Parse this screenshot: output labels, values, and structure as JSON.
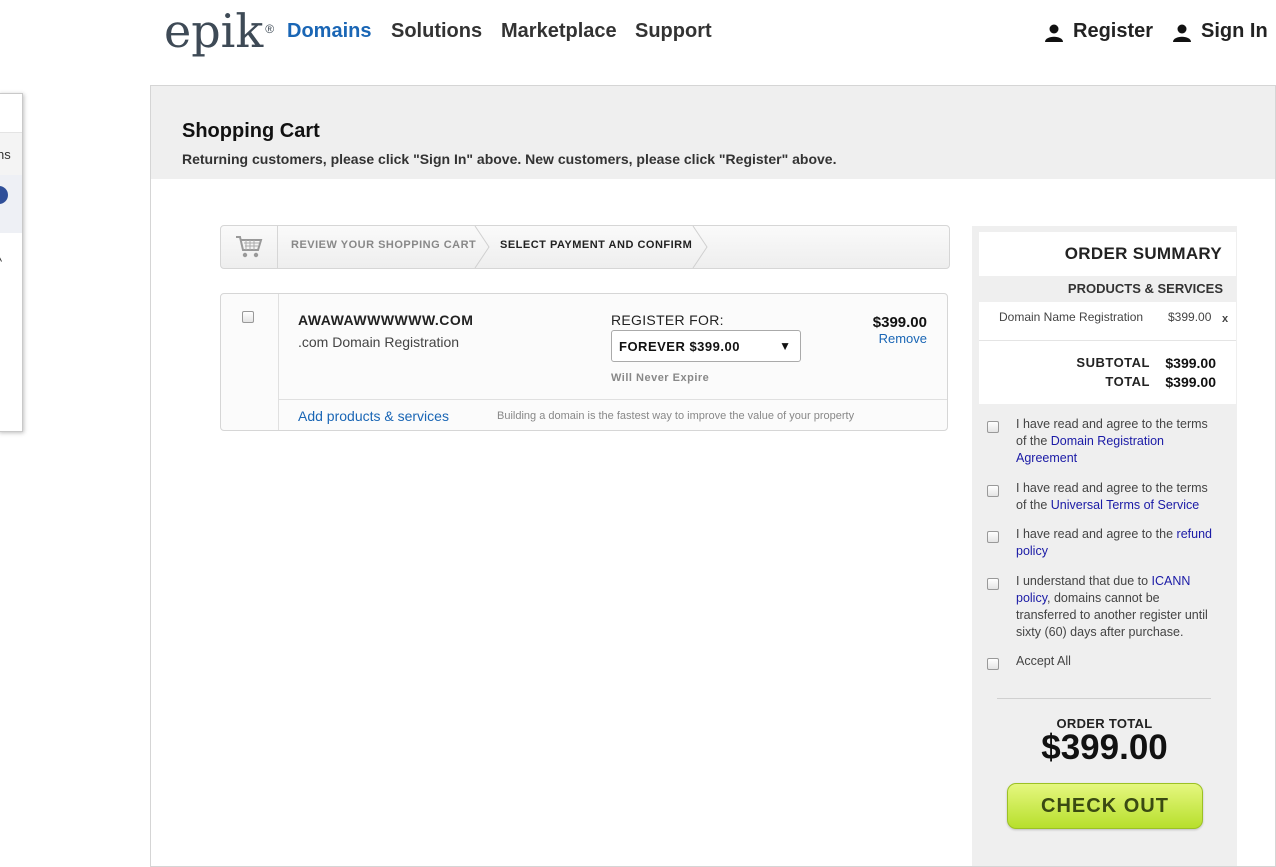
{
  "header": {
    "logo_text": "epik",
    "logo_mark": "®",
    "nav": [
      {
        "label": "Domains",
        "active": true
      },
      {
        "label": "Solutions"
      },
      {
        "label": "Marketplace"
      },
      {
        "label": "Support"
      }
    ],
    "register_label": "Register",
    "signin_label": "Sign In",
    "account_icon": "person-icon",
    "accent_color": "#1a66b5"
  },
  "side_panel": {
    "fragment_text": "ns",
    "caret_text": "^"
  },
  "page": {
    "title": "Shopping Cart",
    "subtitle": "Returning customers, please click \"Sign In\" above. New customers, please click \"Register\" above."
  },
  "steps": {
    "icon": "shopping-cart-icon",
    "items": [
      {
        "label": "REVIEW YOUR SHOPPING CART",
        "current": false
      },
      {
        "label": "SELECT PAYMENT AND CONFIRM",
        "current": true
      }
    ]
  },
  "cart": {
    "items": [
      {
        "domain": "AWAWAWWWWWW.COM",
        "type": ".com Domain Registration",
        "register_for_label": "REGISTER FOR:",
        "term_selected": "FOREVER $399.00",
        "expire_note": "Will Never Expire",
        "price": "$399.00",
        "remove_label": "Remove"
      }
    ],
    "add_link": "Add products & services",
    "footer_note": "Building a domain is the fastest way to improve the value of your property"
  },
  "summary": {
    "title": "ORDER SUMMARY",
    "subtitle": "PRODUCTS & SERVICES",
    "lines": [
      {
        "name": "Domain Name Registration",
        "price": "$399.00",
        "remove": "x"
      }
    ],
    "subtotal_label": "SUBTOTAL",
    "subtotal": "$399.00",
    "total_label": "TOTAL",
    "total": "$399.00",
    "agreements": [
      {
        "before": "I have read and agree to the terms of the ",
        "link": "Domain Registration Agreement",
        "after": ""
      },
      {
        "before": "I have read and agree to the terms of the ",
        "link": "Universal Terms of Service",
        "after": ""
      },
      {
        "before": "I have read and agree to the ",
        "link": "refund policy",
        "after": ""
      },
      {
        "before": "I understand that due to ",
        "link": "ICANN policy",
        "after": ", domains cannot be transferred to another register until sixty (60) days after purchase."
      }
    ],
    "accept_all": "Accept All",
    "order_total_label": "ORDER TOTAL",
    "order_total": "$399.00",
    "checkout_label": "CHECK OUT",
    "checkout_color": "#c8ea4a"
  }
}
